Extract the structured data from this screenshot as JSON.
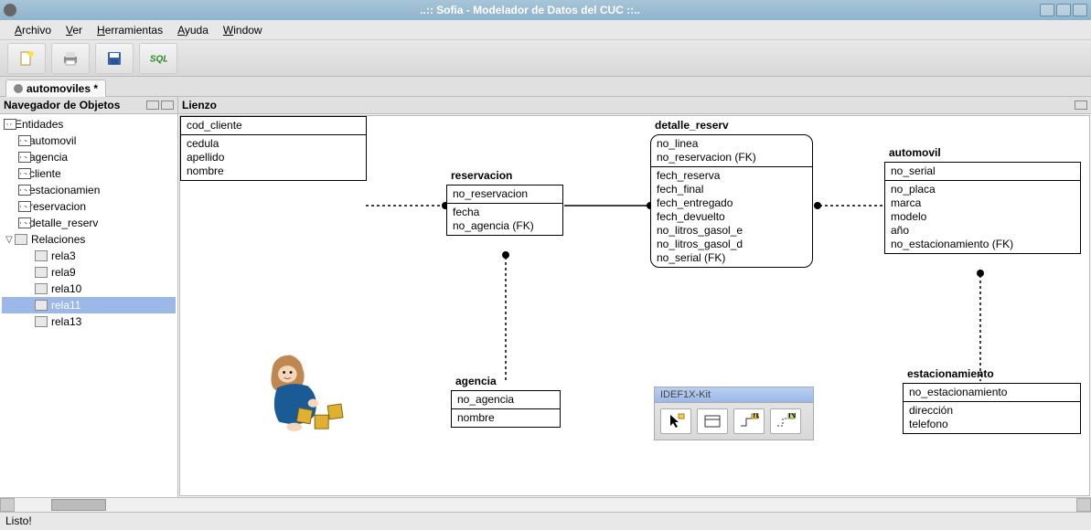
{
  "window": {
    "title": "..:: Sofia - Modelador de Datos del CUC ::.."
  },
  "menu": {
    "archivo": "Archivo",
    "ver": "Ver",
    "herramientas": "Herramientas",
    "ayuda": "Ayuda",
    "window": "Window"
  },
  "tab": {
    "label": "automoviles *"
  },
  "sidebar": {
    "title": "Navegador de Objetos",
    "entidades": "Entidades",
    "relaciones": "Relaciones",
    "entity_items": [
      "automovil",
      "agencia",
      "cliente",
      "estacionamien",
      "reservacion",
      "detalle_reserv"
    ],
    "relation_items": [
      "rela3",
      "rela9",
      "rela10",
      "rela11",
      "rela13"
    ],
    "selected": "rela11"
  },
  "canvas": {
    "title": "Lienzo"
  },
  "entities": {
    "cliente": {
      "name": "cliente",
      "key": [
        "cod_cliente"
      ],
      "attrs": [
        "cedula",
        "apellido",
        "nombre"
      ]
    },
    "reservacion": {
      "name": "reservacion",
      "key": [
        "no_reservacion"
      ],
      "attrs": [
        "fecha",
        "no_agencia (FK)"
      ]
    },
    "detalle_reserv": {
      "name": "detalle_reserv",
      "key": [
        "no_linea",
        "no_reservacion (FK)"
      ],
      "attrs": [
        "fech_reserva",
        "fech_final",
        "fech_entregado",
        "fech_devuelto",
        "no_litros_gasol_e",
        "no_litros_gasol_d",
        "no_serial (FK)"
      ]
    },
    "automovil": {
      "name": "automovil",
      "key": [
        "no_serial"
      ],
      "attrs": [
        "no_placa",
        "marca",
        "modelo",
        "año",
        "no_estacionamiento (FK)"
      ]
    },
    "agencia": {
      "name": "agencia",
      "key": [
        "no_agencia"
      ],
      "attrs": [
        "nombre"
      ]
    },
    "estacionamiento": {
      "name": "estacionamiento",
      "key": [
        "no_estacionamiento"
      ],
      "attrs": [
        "dirección",
        "telefono"
      ]
    }
  },
  "kit": {
    "title": "IDEF1X-Kit"
  },
  "status": {
    "text": "Listo!"
  }
}
